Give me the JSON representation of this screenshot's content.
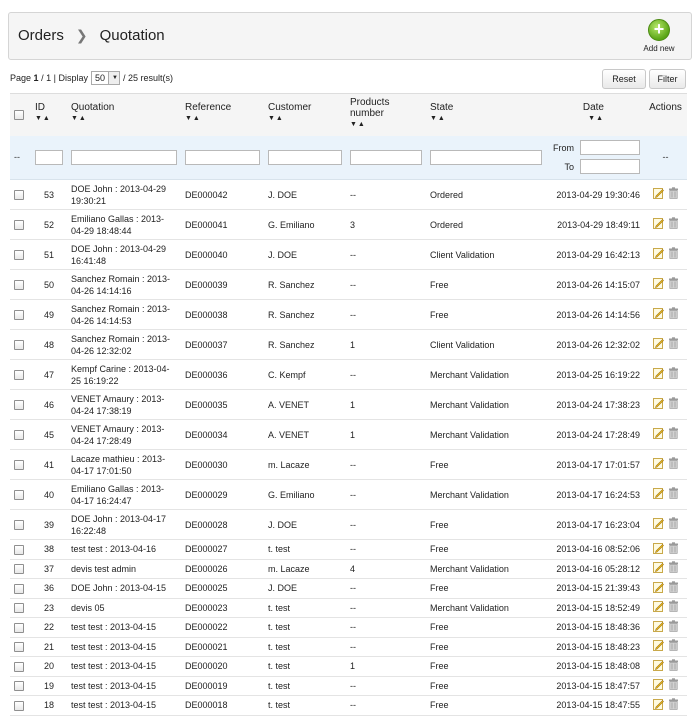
{
  "breadcrumb": {
    "root": "Orders",
    "current": "Quotation"
  },
  "toolbar": {
    "add_new": "Add new",
    "reset": "Reset",
    "filter": "Filter"
  },
  "pager": {
    "page_label": "Page",
    "current_page": "1",
    "of": "/ 1",
    "display_label": "| Display",
    "per_page": "50",
    "results": "/ 25 result(s)"
  },
  "columns": {
    "id": "ID",
    "quotation": "Quotation",
    "reference": "Reference",
    "customer": "Customer",
    "products_line1": "Products",
    "products_line2": "number",
    "state": "State",
    "date": "Date",
    "actions": "Actions"
  },
  "filters": {
    "dash": "--",
    "from": "From",
    "to": "To",
    "actions_dash": "--"
  },
  "rows": [
    {
      "id": "53",
      "quotation": "DOE John : 2013-04-29 19:30:21",
      "reference": "DE000042",
      "customer": "J. DOE",
      "products": "--",
      "state": "Ordered",
      "date": "2013-04-29 19:30:46",
      "tall": true
    },
    {
      "id": "52",
      "quotation": "Emiliano Gallas : 2013-04-29 18:48:44",
      "reference": "DE000041",
      "customer": "G. Emiliano",
      "products": "3",
      "state": "Ordered",
      "date": "2013-04-29 18:49:11",
      "tall": true
    },
    {
      "id": "51",
      "quotation": "DOE John : 2013-04-29 16:41:48",
      "reference": "DE000040",
      "customer": "J. DOE",
      "products": "--",
      "state": "Client Validation",
      "date": "2013-04-29 16:42:13",
      "tall": true
    },
    {
      "id": "50",
      "quotation": "Sanchez Romain : 2013-04-26 14:14:16",
      "reference": "DE000039",
      "customer": "R. Sanchez",
      "products": "--",
      "state": "Free",
      "date": "2013-04-26 14:15:07",
      "tall": true
    },
    {
      "id": "49",
      "quotation": "Sanchez Romain : 2013-04-26 14:14:53",
      "reference": "DE000038",
      "customer": "R. Sanchez",
      "products": "--",
      "state": "Free",
      "date": "2013-04-26 14:14:56",
      "tall": true
    },
    {
      "id": "48",
      "quotation": "Sanchez Romain : 2013-04-26 12:32:02",
      "reference": "DE000037",
      "customer": "R. Sanchez",
      "products": "1",
      "state": "Client Validation",
      "date": "2013-04-26 12:32:02",
      "tall": true
    },
    {
      "id": "47",
      "quotation": "Kempf Carine : 2013-04-25 16:19:22",
      "reference": "DE000036",
      "customer": "C. Kempf",
      "products": "--",
      "state": "Merchant Validation",
      "date": "2013-04-25 16:19:22",
      "tall": true
    },
    {
      "id": "46",
      "quotation": "VENET Amaury : 2013-04-24 17:38:19",
      "reference": "DE000035",
      "customer": "A. VENET",
      "products": "1",
      "state": "Merchant Validation",
      "date": "2013-04-24 17:38:23",
      "tall": true
    },
    {
      "id": "45",
      "quotation": "VENET Amaury : 2013-04-24 17:28:49",
      "reference": "DE000034",
      "customer": "A. VENET",
      "products": "1",
      "state": "Merchant Validation",
      "date": "2013-04-24 17:28:49",
      "tall": true
    },
    {
      "id": "41",
      "quotation": "Lacaze mathieu : 2013-04-17 17:01:50",
      "reference": "DE000030",
      "customer": "m. Lacaze",
      "products": "--",
      "state": "Free",
      "date": "2013-04-17 17:01:57",
      "tall": true
    },
    {
      "id": "40",
      "quotation": "Emiliano Gallas : 2013-04-17 16:24:47",
      "reference": "DE000029",
      "customer": "G. Emiliano",
      "products": "--",
      "state": "Merchant Validation",
      "date": "2013-04-17 16:24:53",
      "tall": true
    },
    {
      "id": "39",
      "quotation": "DOE John : 2013-04-17 16:22:48",
      "reference": "DE000028",
      "customer": "J. DOE",
      "products": "--",
      "state": "Free",
      "date": "2013-04-17 16:23:04",
      "tall": true
    },
    {
      "id": "38",
      "quotation": "test test : 2013-04-16",
      "reference": "DE000027",
      "customer": "t. test",
      "products": "--",
      "state": "Free",
      "date": "2013-04-16 08:52:06",
      "tall": false
    },
    {
      "id": "37",
      "quotation": "devis test admin",
      "reference": "DE000026",
      "customer": "m. Lacaze",
      "products": "4",
      "state": "Merchant Validation",
      "date": "2013-04-16 05:28:12",
      "tall": false
    },
    {
      "id": "36",
      "quotation": "DOE John : 2013-04-15",
      "reference": "DE000025",
      "customer": "J. DOE",
      "products": "--",
      "state": "Free",
      "date": "2013-04-15 21:39:43",
      "tall": false
    },
    {
      "id": "23",
      "quotation": "devis 05",
      "reference": "DE000023",
      "customer": "t. test",
      "products": "--",
      "state": "Merchant Validation",
      "date": "2013-04-15 18:52:49",
      "tall": false
    },
    {
      "id": "22",
      "quotation": "test test : 2013-04-15",
      "reference": "DE000022",
      "customer": "t. test",
      "products": "--",
      "state": "Free",
      "date": "2013-04-15 18:48:36",
      "tall": false
    },
    {
      "id": "21",
      "quotation": "test test : 2013-04-15",
      "reference": "DE000021",
      "customer": "t. test",
      "products": "--",
      "state": "Free",
      "date": "2013-04-15 18:48:23",
      "tall": false
    },
    {
      "id": "20",
      "quotation": "test test : 2013-04-15",
      "reference": "DE000020",
      "customer": "t. test",
      "products": "1",
      "state": "Free",
      "date": "2013-04-15 18:48:08",
      "tall": false
    },
    {
      "id": "19",
      "quotation": "test test : 2013-04-15",
      "reference": "DE000019",
      "customer": "t. test",
      "products": "--",
      "state": "Free",
      "date": "2013-04-15 18:47:57",
      "tall": false
    },
    {
      "id": "18",
      "quotation": "test test : 2013-04-15",
      "reference": "DE000018",
      "customer": "t. test",
      "products": "--",
      "state": "Free",
      "date": "2013-04-15 18:47:55",
      "tall": false
    }
  ]
}
